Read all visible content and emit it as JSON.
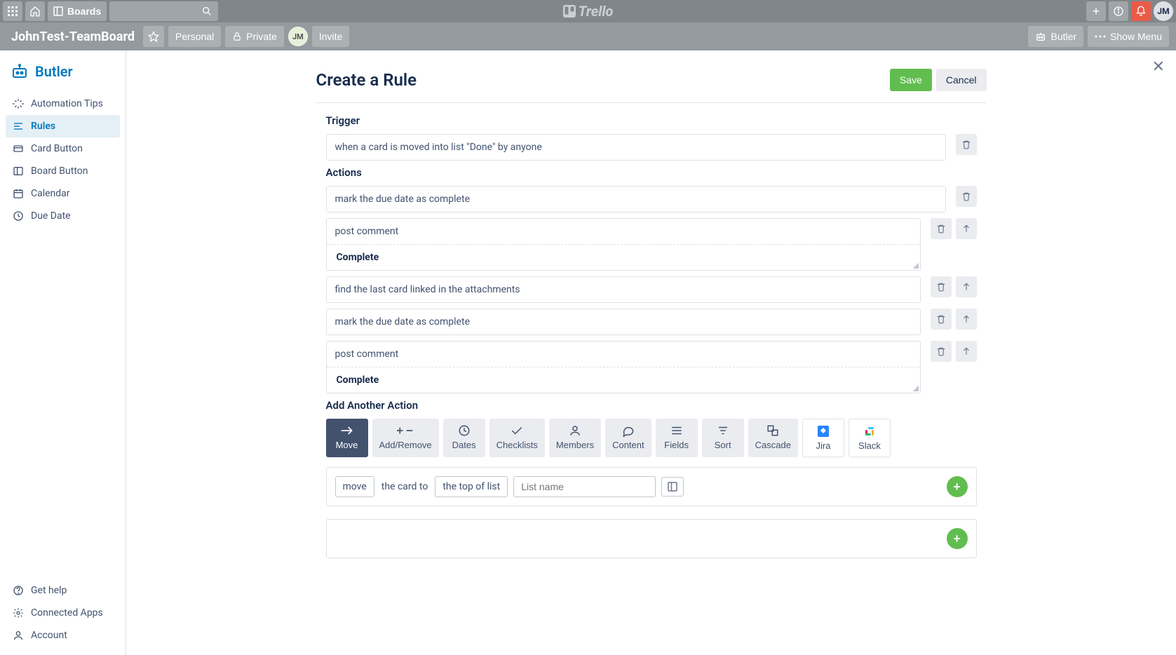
{
  "topbar": {
    "boards_label": "Boards",
    "avatar_initials": "JM"
  },
  "boardbar": {
    "title": "JohnTest-TeamBoard",
    "visibility_team": "Personal",
    "visibility_private": "Private",
    "member_initials": "JM",
    "invite_label": "Invite",
    "butler_label": "Butler",
    "menu_label": "Show Menu"
  },
  "sidebar": {
    "title": "Butler",
    "items": [
      {
        "label": "Automation Tips"
      },
      {
        "label": "Rules"
      },
      {
        "label": "Card Button"
      },
      {
        "label": "Board Button"
      },
      {
        "label": "Calendar"
      },
      {
        "label": "Due Date"
      }
    ],
    "bottom": [
      {
        "label": "Get help"
      },
      {
        "label": "Connected Apps"
      },
      {
        "label": "Account"
      }
    ]
  },
  "page": {
    "title": "Create a Rule",
    "save": "Save",
    "cancel": "Cancel"
  },
  "rule": {
    "trigger_heading": "Trigger",
    "trigger_text": "when a card is moved into list \"Done\" by anyone",
    "actions_heading": "Actions",
    "actions": [
      {
        "text": "mark the due date as complete",
        "has_sub": false,
        "has_up": false
      },
      {
        "text": "post comment",
        "has_sub": true,
        "sub": "Complete",
        "has_up": true
      },
      {
        "text": "find the last card linked in the attachments",
        "has_sub": false,
        "has_up": true
      },
      {
        "text": "mark the due date as complete",
        "has_sub": false,
        "has_up": true
      },
      {
        "text": "post comment",
        "has_sub": true,
        "sub": "Complete",
        "has_up": true
      }
    ],
    "add_heading": "Add Another Action",
    "tabs": [
      {
        "label": "Move"
      },
      {
        "label": "Add/Remove"
      },
      {
        "label": "Dates"
      },
      {
        "label": "Checklists"
      },
      {
        "label": "Members"
      },
      {
        "label": "Content"
      },
      {
        "label": "Fields"
      },
      {
        "label": "Sort"
      },
      {
        "label": "Cascade"
      },
      {
        "label": "Jira"
      },
      {
        "label": "Slack"
      }
    ],
    "builder": {
      "verb": "move",
      "mid": "the card to",
      "position": "the top of list",
      "list_placeholder": "List name"
    }
  }
}
